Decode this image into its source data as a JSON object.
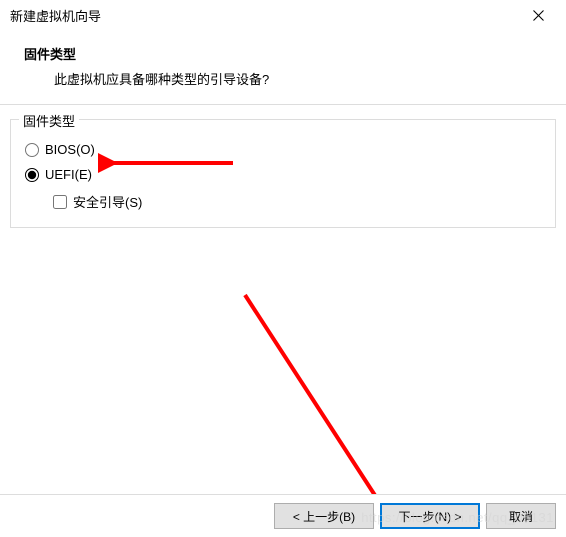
{
  "window": {
    "title": "新建虚拟机向导"
  },
  "header": {
    "heading": "固件类型",
    "subheading": "此虚拟机应具备哪种类型的引导设备?"
  },
  "fieldset": {
    "legend": "固件类型",
    "options": {
      "bios": {
        "label": "BIOS(O)",
        "selected": false
      },
      "uefi": {
        "label": "UEFI(E)",
        "selected": true
      },
      "secureboot": {
        "label": "安全引导(S)",
        "checked": false
      }
    }
  },
  "buttons": {
    "back": "< 上一步(B)",
    "next": "下一步(N) >",
    "cancel": "取消"
  },
  "watermark": "https://blog.csdn.net/qq_05131",
  "annotations": {
    "arrow1_color": "#ff0000",
    "arrow2_color": "#ff0000"
  }
}
